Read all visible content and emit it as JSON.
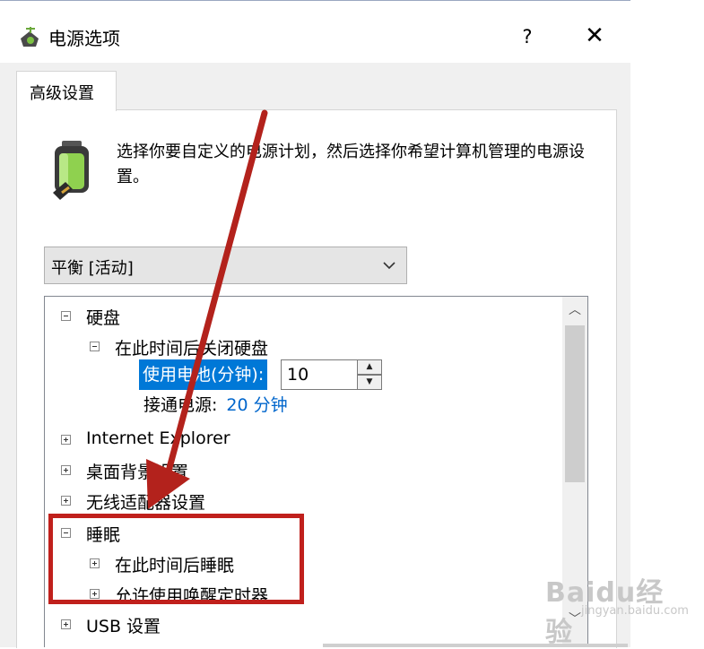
{
  "window": {
    "title": "电源选项",
    "help_label": "?",
    "close_label": "✕"
  },
  "tab": {
    "label": "高级设置"
  },
  "description": "选择你要自定义的电源计划，然后选择你希望计算机管理的电源设置。",
  "plan_select": {
    "value": "平衡 [活动]"
  },
  "tree": {
    "hard_disk": "硬盘",
    "turn_off_disk": "在此时间后关闭硬盘",
    "on_battery_label": "使用电池(分钟):",
    "on_battery_value": "10",
    "plugged_in_label": "接通电源:",
    "plugged_in_value": "20 分钟",
    "internet_explorer": "Internet Explorer",
    "desktop_background": "桌面背景设置",
    "wireless_adapter": "无线适配器设置",
    "sleep": "睡眠",
    "sleep_after": "在此时间后睡眠",
    "allow_wake_timers": "允许使用唤醒定时器",
    "usb": "USB 设置"
  },
  "watermark": {
    "main": "Baidu经验",
    "sub": "jingyan.baidu.com"
  },
  "colors": {
    "annotation_red": "#c0201c",
    "selection_blue": "#0078d7",
    "link_blue": "#0066cc"
  }
}
